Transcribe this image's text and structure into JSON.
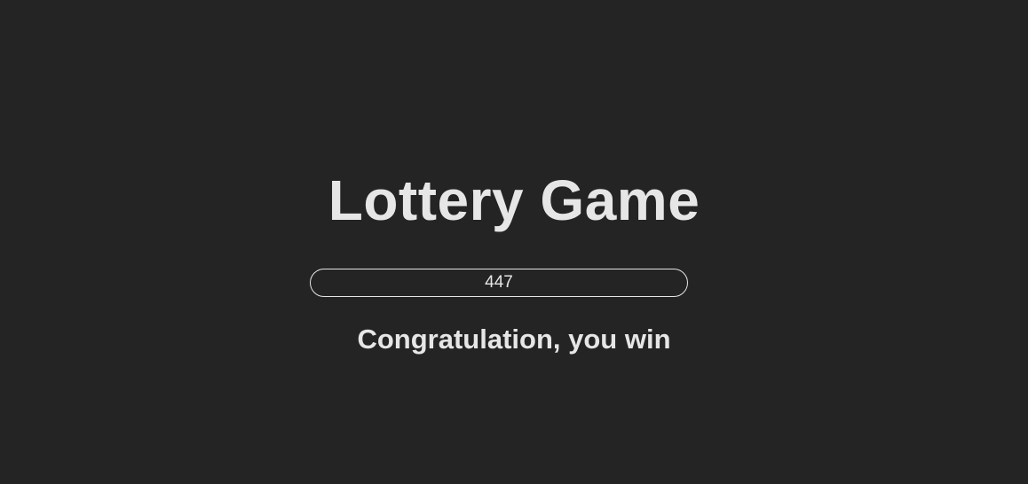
{
  "app": {
    "title": "Lottery Game"
  },
  "guess_input": {
    "value": "447",
    "placeholder": ""
  },
  "result": {
    "message": "Congratulation, you win"
  },
  "colors": {
    "background": "#242424",
    "text": "#e6e6e6",
    "input_border": "#e6e6e6"
  }
}
